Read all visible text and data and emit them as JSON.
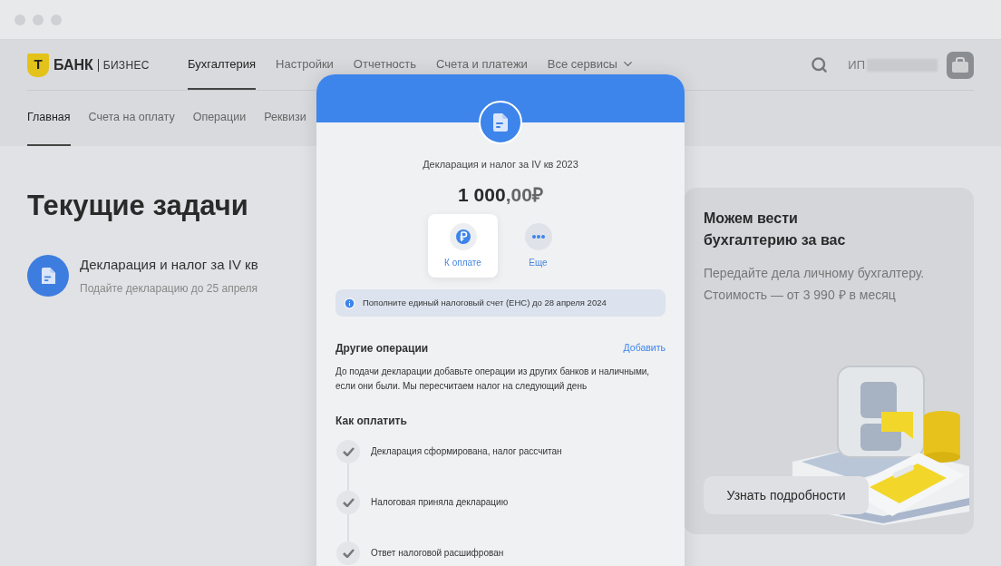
{
  "logo": {
    "mark": "Т",
    "name": "БАНК",
    "suffix": "БИЗНЕС"
  },
  "nav": [
    {
      "label": "Бухгалтерия",
      "selected": true
    },
    {
      "label": "Настройки",
      "selected": false
    },
    {
      "label": "Отчетность",
      "selected": false
    },
    {
      "label": "Счета и платежи",
      "selected": false
    },
    {
      "label": "Все сервисы",
      "selected": false,
      "kind": "dropdown"
    }
  ],
  "account": {
    "prefix": "ИП"
  },
  "subnav": [
    {
      "label": "Главная",
      "selected": true
    },
    {
      "label": "Счета на оплату",
      "selected": false
    },
    {
      "label": "Операции",
      "selected": false
    },
    {
      "label": "Реквизи",
      "selected": false
    }
  ],
  "page_title": "Текущие задачи",
  "tasks": [
    {
      "title": "Декларация и налог за IV кв",
      "subtitle": "Подайте декларацию до 25 апреля"
    }
  ],
  "promo": {
    "title": "Можем вести бухгалтерию за вас",
    "text": "Передайте дела личному бухгалтеру. Стоимость — от 3 990 ₽ в месяц",
    "button": "Узнать подробности"
  },
  "modal": {
    "title": "Декларация и налог за IV кв 2023",
    "amount_main": "1 000",
    "amount_fraction": ",00",
    "currency": "₽",
    "actions": [
      {
        "label": "К оплате",
        "kind": "pay",
        "selected": true
      },
      {
        "label": "Еще",
        "kind": "more",
        "selected": false
      }
    ],
    "notice": "Пополните единый налоговый счет (ЕНС) до 28 апреля 2024",
    "other_ops": {
      "title": "Другие операции",
      "link": "Добавить",
      "text": "До подачи декларации добавьте операции из других банков и наличными, если они были. Мы пересчитаем налог на следующий день"
    },
    "steps_title": "Как оплатить",
    "steps": [
      {
        "label": "Декларация сформирована, налог рассчитан",
        "done": true
      },
      {
        "label": "Налоговая приняла декларацию",
        "done": true
      },
      {
        "label": "Ответ налоговой расшифрован",
        "done": true
      }
    ]
  }
}
